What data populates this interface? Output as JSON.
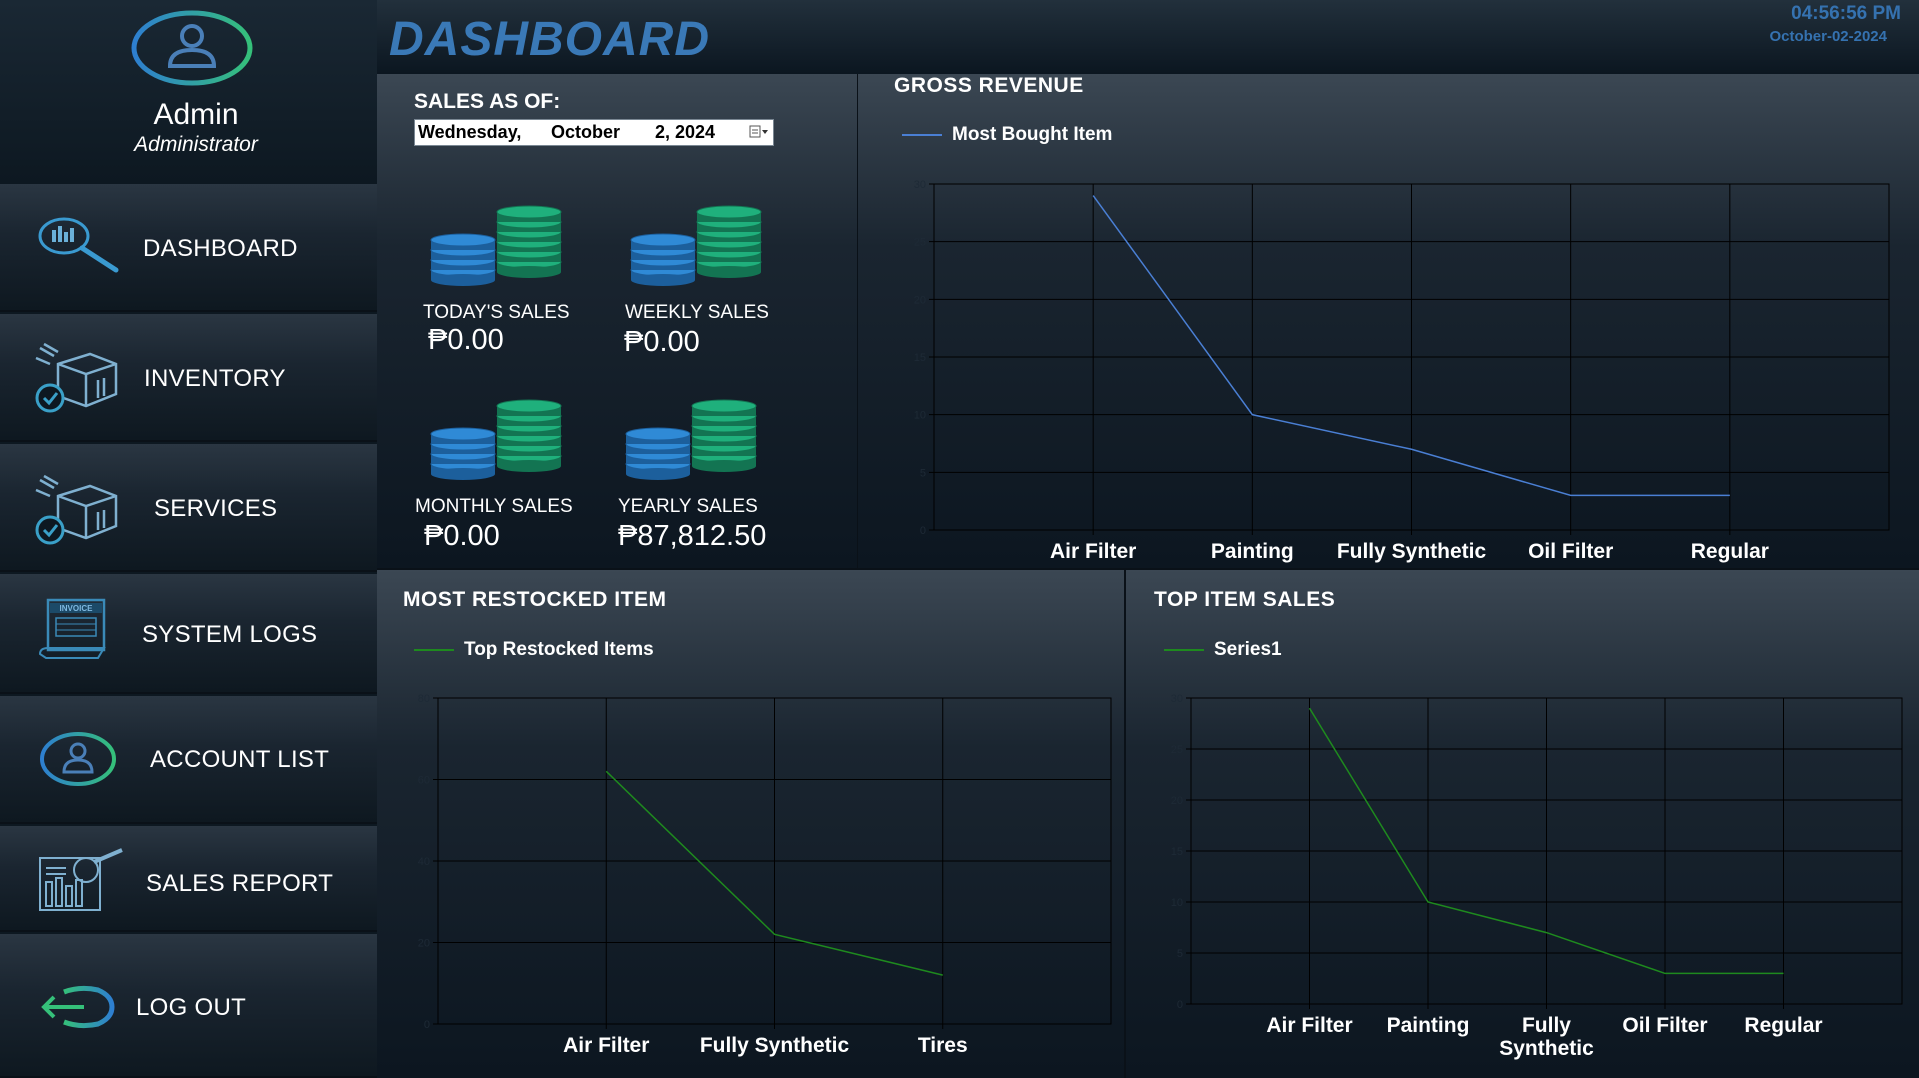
{
  "sidebar": {
    "profile": {
      "name": "Admin",
      "role": "Administrator"
    },
    "items": [
      {
        "label": "DASHBOARD",
        "icon": "dashboard-search-icon"
      },
      {
        "label": "INVENTORY",
        "icon": "box-icon"
      },
      {
        "label": "SERVICES",
        "icon": "box-icon"
      },
      {
        "label": "SYSTEM LOGS",
        "icon": "invoice-icon"
      },
      {
        "label": "ACCOUNT LIST",
        "icon": "user-icon"
      },
      {
        "label": "SALES REPORT",
        "icon": "report-icon"
      },
      {
        "label": "LOG OUT",
        "icon": "logout-icon"
      }
    ],
    "invoice_icon_text": "INVOICE"
  },
  "header": {
    "title": "DASHBOARD",
    "time": "04:56:56 PM",
    "date": "October-02-2024"
  },
  "sales": {
    "as_of_label": "SALES AS OF:",
    "picker": {
      "day": "Wednesday,",
      "month": "October",
      "date": "2, 2024"
    },
    "today": {
      "label": "TODAY'S SALES",
      "value": "₱0.00"
    },
    "weekly": {
      "label": "WEEKLY SALES",
      "value": "₱0.00"
    },
    "monthly": {
      "label": "MONTHLY SALES",
      "value": "₱0.00"
    },
    "yearly": {
      "label": "YEARLY SALES",
      "value": "₱87,812.50"
    }
  },
  "colors": {
    "accent": "#3a79b7",
    "blue_series": "#4a7fd4",
    "green_series": "#1e8a1e",
    "coin_blue": "#2f8ad6",
    "coin_green": "#1fb07c"
  },
  "chart_data": [
    {
      "id": "gross",
      "type": "line",
      "title": "GROSS REVENUE",
      "categories": [
        "Air Filter",
        "Painting",
        "Fully Synthetic",
        "Oil Filter",
        "Regular"
      ],
      "series": [
        {
          "name": "Most Bought Item",
          "values": [
            29,
            10,
            7,
            3,
            3
          ]
        }
      ],
      "ylim": [
        0,
        30
      ],
      "yticks": [
        0,
        5,
        10,
        15,
        20,
        25,
        30
      ],
      "grid": true,
      "legend": "top-left"
    },
    {
      "id": "restock",
      "type": "line",
      "title": "MOST RESTOCKED ITEM",
      "categories": [
        "Air Filter",
        "Fully Synthetic",
        "Tires"
      ],
      "series": [
        {
          "name": "Top Restocked Items",
          "values": [
            62,
            22,
            12
          ]
        }
      ],
      "ylim": [
        0,
        80
      ],
      "yticks": [
        0,
        20,
        40,
        60,
        80
      ],
      "grid": true,
      "legend": "top-left"
    },
    {
      "id": "topsales",
      "type": "line",
      "title": "TOP ITEM SALES",
      "categories": [
        "Air Filter",
        "Painting",
        "Fully Synthetic",
        "Oil Filter",
        "Regular"
      ],
      "series": [
        {
          "name": "Series1",
          "values": [
            29,
            10,
            7,
            3,
            3
          ]
        }
      ],
      "ylim": [
        0,
        30
      ],
      "yticks": [
        0,
        5,
        10,
        15,
        20,
        25,
        30
      ],
      "grid": true,
      "legend": "top-left"
    }
  ]
}
